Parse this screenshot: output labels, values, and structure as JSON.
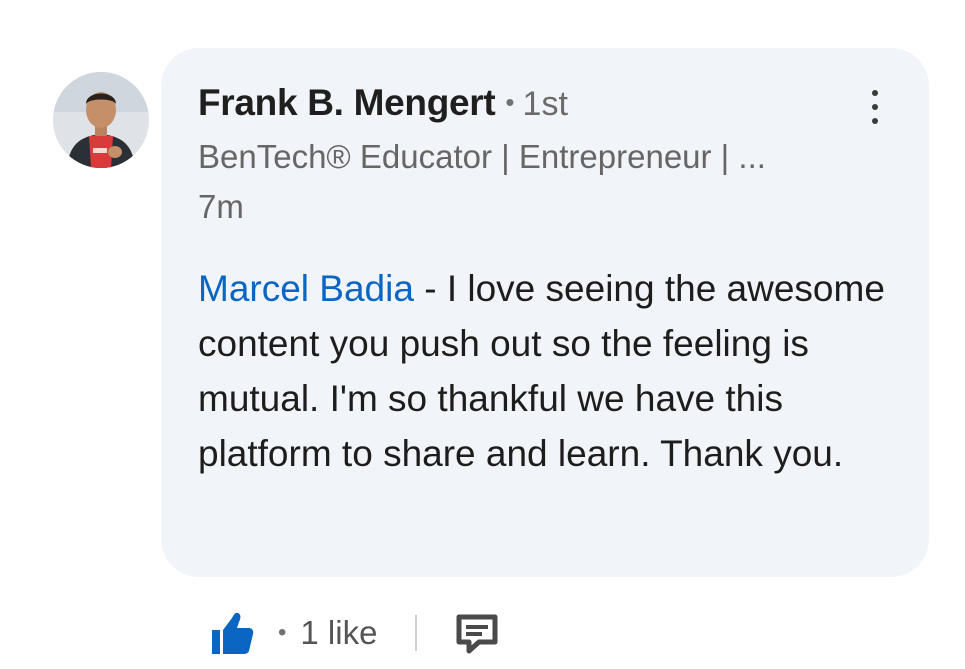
{
  "comment": {
    "author_name": "Frank B. Mengert",
    "separator": "•",
    "connection_degree": "1st",
    "headline": "BenTech® Educator | Entrepreneur | ...",
    "timestamp": "7m",
    "mention": "Marcel Badia",
    "body_text": " - I love seeing the awesome content you push out so the feeling is mutual. I'm so thankful we have this platform to share and learn. Thank you."
  },
  "actions": {
    "separator": "•",
    "like_count": "1 like"
  },
  "icons": {
    "avatar": "profile-photo",
    "more": "vertical-ellipsis-icon",
    "like": "thumbs-up-icon",
    "reply": "comment-icon"
  },
  "colors": {
    "accent": "#0a66c2",
    "bubble": "#f1f4f8",
    "text": "#1d1d1d",
    "muted": "#666666"
  }
}
